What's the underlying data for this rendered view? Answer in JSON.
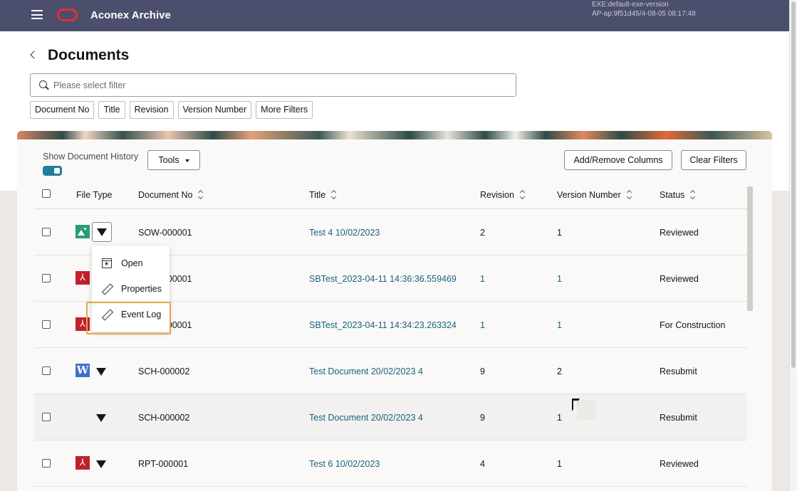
{
  "header": {
    "app_title": "Aconex Archive",
    "version_line1": "EXE:default-exe-version",
    "version_line2": "AP-ap:9f51d45/4-08-05 08:17:48",
    "brand_color": "#4b4e6c",
    "logo_color": "#e0322f"
  },
  "page": {
    "title": "Documents",
    "search_placeholder": "Please select filter",
    "filter_chips": [
      "Document No",
      "Title",
      "Revision",
      "Version Number",
      "More Filters"
    ]
  },
  "toolbar": {
    "show_history_label": "Show Document History",
    "show_history_on": true,
    "tools_label": "Tools",
    "add_remove_columns_label": "Add/Remove Columns",
    "clear_filters_label": "Clear Filters"
  },
  "table": {
    "columns": {
      "file_type": "File Type",
      "document_no": "Document No",
      "title": "Title",
      "revision": "Revision",
      "version_number": "Version Number",
      "status": "Status"
    },
    "rows": [
      {
        "file_type": "image",
        "file_icon": "image-icon",
        "document_no": "SOW-000001",
        "title": "Test 4 10/02/2023",
        "revision": "2",
        "version_number": "1",
        "status": "Reviewed"
      },
      {
        "file_type": "pdf",
        "file_icon": "pdf-icon",
        "document_no": "SOW-000001",
        "title": "SBTest_2023-04-11 14:36:36.559469",
        "revision": "1",
        "version_number": "1",
        "status": "Reviewed"
      },
      {
        "file_type": "pdf",
        "file_icon": "pdf-icon",
        "document_no": "SOW-000001",
        "title": "SBTest_2023-04-11 14:34:23.263324",
        "revision": "1",
        "version_number": "1",
        "status": "For Construction"
      },
      {
        "file_type": "word",
        "file_icon": "word-icon",
        "document_no": "SCH-000002",
        "title": "Test Document 20/02/2023 4",
        "revision": "9",
        "version_number": "2",
        "status": "Resubmit"
      },
      {
        "file_type": "none",
        "file_icon": "",
        "document_no": "SCH-000002",
        "title": "Test Document 20/02/2023 4",
        "revision": "9",
        "version_number": "1",
        "status": "Resubmit"
      },
      {
        "file_type": "pdf",
        "file_icon": "pdf-icon",
        "document_no": "RPT-000001",
        "title": "Test 6 10/02/2023",
        "revision": "4",
        "version_number": "1",
        "status": "Reviewed"
      }
    ]
  },
  "context_menu": {
    "items": [
      {
        "label": "Open",
        "icon": "open-icon"
      },
      {
        "label": "Properties",
        "icon": "pencil-icon"
      },
      {
        "label": "Event Log",
        "icon": "pencil-icon"
      }
    ],
    "highlighted": "Event Log",
    "highlight_color": "#e3a64a"
  }
}
